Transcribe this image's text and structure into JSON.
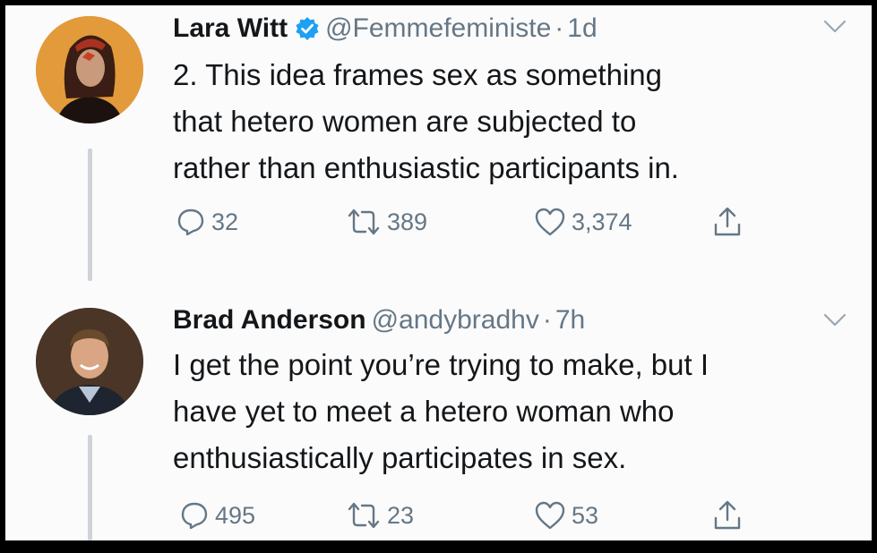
{
  "tweets": [
    {
      "name": "Lara Witt",
      "verified": true,
      "handle": "@Femmefeministe",
      "separator": "·",
      "time": "1d",
      "text": "2. This idea frames sex as something\nthat hetero women are subjected to\nrather than enthusiastic participants in.",
      "actions": {
        "replies": "32",
        "retweets": "389",
        "likes": "3,374"
      }
    },
    {
      "name": "Brad Anderson",
      "verified": false,
      "handle": "@andybradhv",
      "separator": "·",
      "time": "7h",
      "text": "I get the point you’re trying to make, but I\nhave yet to meet a hetero woman who\nenthusiastically participates in sex.",
      "actions": {
        "replies": "495",
        "retweets": "23",
        "likes": "53"
      }
    }
  ],
  "icons": {
    "reply": "reply-icon",
    "retweet": "retweet-icon",
    "like": "heart-icon",
    "share": "share-icon",
    "verified": "verified-badge-icon",
    "menu": "chevron-down-icon"
  },
  "colors": {
    "text": "#14171a",
    "secondary": "#657786",
    "verified": "#1da1f2",
    "thread_line": "#cdd3d8",
    "background": "#fbfbfb"
  }
}
